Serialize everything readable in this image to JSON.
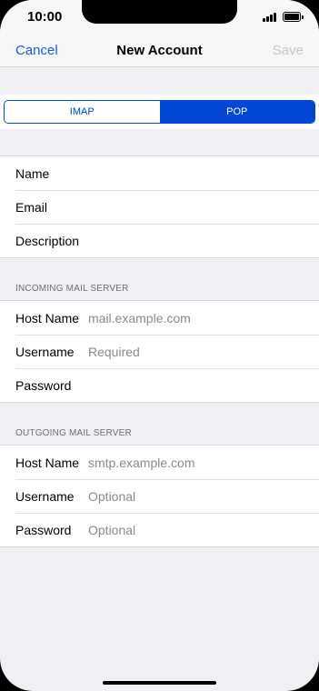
{
  "status_bar": {
    "time": "10:00"
  },
  "nav": {
    "cancel_label": "Cancel",
    "title": "New Account",
    "save_label": "Save"
  },
  "segmented": {
    "options": [
      "IMAP",
      "POP"
    ],
    "selected": "POP"
  },
  "account_fields": [
    {
      "label": "Name"
    },
    {
      "label": "Email"
    },
    {
      "label": "Description"
    }
  ],
  "incoming": {
    "header": "INCOMING MAIL SERVER",
    "fields": [
      {
        "label": "Host Name",
        "placeholder": "mail.example.com"
      },
      {
        "label": "Username",
        "placeholder": "Required"
      },
      {
        "label": "Password",
        "placeholder": ""
      }
    ]
  },
  "outgoing": {
    "header": "OUTGOING MAIL SERVER",
    "fields": [
      {
        "label": "Host Name",
        "placeholder": "smtp.example.com"
      },
      {
        "label": "Username",
        "placeholder": "Optional"
      },
      {
        "label": "Password",
        "placeholder": "Optional"
      }
    ]
  },
  "colors": {
    "accent": "#0047d4",
    "link": "#1a5fd8",
    "background": "#efeff4",
    "placeholder": "#8a8a8e"
  }
}
